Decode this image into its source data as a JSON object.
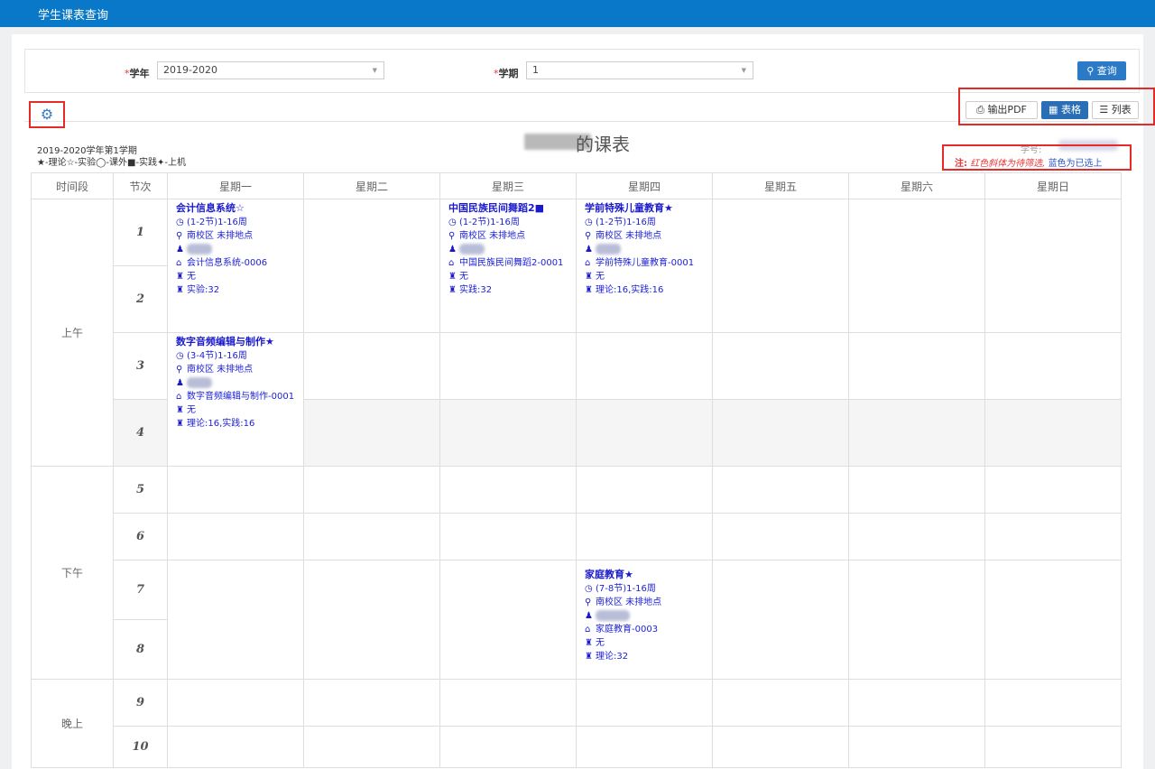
{
  "app": {
    "title": "学生课表查询"
  },
  "filters": {
    "year_label": "学年",
    "year_value": "2019-2020",
    "term_label": "学期",
    "term_value": "1",
    "required_mark": "*",
    "query_button": "查询"
  },
  "toolbar": {
    "export_pdf": "输出PDF",
    "table_view": "表格",
    "list_view": "列表"
  },
  "schedule": {
    "term_info": "2019-2020学年第1学期",
    "legend": "★-理论☆-实验◯-课外■-实践✦-上机",
    "title": "的课表",
    "student_id_label": "学号:",
    "note_label": "注:",
    "note_red": "红色斜体为待筛选,",
    "note_blue": "蓝色为已选上",
    "headers": [
      "时间段",
      "节次",
      "星期一",
      "星期二",
      "星期三",
      "星期四",
      "星期五",
      "星期六",
      "星期日"
    ],
    "periods": [
      "上午",
      "下午",
      "晚上"
    ],
    "sessions": [
      "1",
      "2",
      "3",
      "4",
      "5",
      "6",
      "7",
      "8",
      "9",
      "10"
    ]
  },
  "courses": {
    "mon_1": {
      "name": "会计信息系统☆",
      "time": "(1-2节)1-16周",
      "location": "南校区 未排地点",
      "class": "会计信息系统-0006",
      "extra": "无",
      "hours": "实验:32"
    },
    "wed_1": {
      "name": "中国民族民间舞蹈2■",
      "time": "(1-2节)1-16周",
      "location": "南校区 未排地点",
      "class": "中国民族民间舞蹈2-0001",
      "extra": "无",
      "hours": "实践:32"
    },
    "thu_1": {
      "name": "学前特殊儿童教育★",
      "time": "(1-2节)1-16周",
      "location": "南校区 未排地点",
      "class": "学前特殊儿童教育-0001",
      "extra": "无",
      "hours": "理论:16,实践:16"
    },
    "mon_3": {
      "name": "数字音频编辑与制作★",
      "time": "(3-4节)1-16周",
      "location": "南校区 未排地点",
      "class": "数字音频编辑与制作-0001",
      "extra": "无",
      "hours": "理论:16,实践:16"
    },
    "thu_7": {
      "name": "家庭教育★",
      "time": "(7-8节)1-16周",
      "location": "南校区 未排地点",
      "class": "家庭教育-0003",
      "extra": "无",
      "hours": "理论:32"
    }
  },
  "icons": {
    "settings": "gear-icon",
    "print": "printer-icon",
    "grid": "grid-icon",
    "list": "list-icon",
    "search": "search-icon",
    "clock": "clock-icon",
    "location": "location-pin-icon",
    "teacher": "user-icon",
    "class": "home-icon",
    "extra": "tower-icon"
  },
  "colors": {
    "topbar": "#0a78c8",
    "primary_button": "#2a7ac7",
    "course_text": "#1a1acc",
    "highlight_box": "#e52a2a"
  }
}
